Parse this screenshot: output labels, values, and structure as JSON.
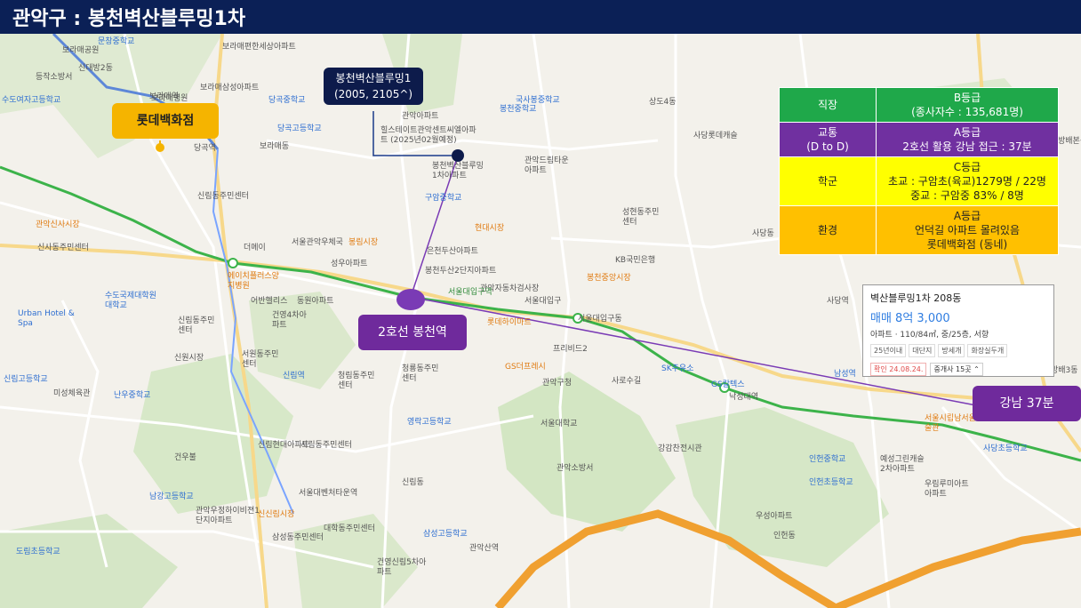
{
  "title": "관악구 : 봉천벽산블루밍1차",
  "complex_callout": {
    "line1": "봉천벽산블루밍1",
    "line2": "(2005, 2105^)"
  },
  "lotte_callout": "롯데백화점",
  "station_callout": "2호선 봉천역",
  "gangnam_callout": "강남 37분",
  "grades": [
    {
      "label": "직장",
      "grade": "B등급",
      "detail": [
        "(종사자수 : 135,681명)"
      ],
      "color": "#1fa84a"
    },
    {
      "label": "교통\n(D to D)",
      "grade": "A등급",
      "detail": [
        "2호선 활용 강남 접근 : 37분"
      ],
      "color": "#7030a0"
    },
    {
      "label": "학군",
      "grade": "C등급",
      "detail": [
        "초교 : 구암초(육교)1279명 / 22명",
        "중교 : 구암중 83% / 8명"
      ],
      "color": "#ffff00"
    },
    {
      "label": "환경",
      "grade": "A등급",
      "detail": [
        "언덕길 아파트 몰려있음",
        "롯데백화점 (동네)"
      ],
      "color": "#ffc000"
    }
  ],
  "listing": {
    "name": "벽산블루밍1차 208동",
    "price": "매매 8억 3,000",
    "spec": "아파트 · 110/84㎡, 중/25층, 서향",
    "tags": [
      "25년이내",
      "대단지",
      "방세개",
      "화장실두개"
    ],
    "confirmed": "확인 24.08.24.",
    "agents": "중개사 15곳 ⌃"
  },
  "map_labels": [
    "문창중학교",
    "보라매공원",
    "신대방2동",
    "등작소방서",
    "수도여자고등학교",
    "보라매병원",
    "보라매편한세상아파트",
    "보라매삼성아파트",
    "당곡중학교",
    "당곡고등학교",
    "보라매동",
    "봉천역",
    "당곡역",
    "신림동주민센터",
    "더메이",
    "서울관악우체국",
    "봉림시장",
    "성우아파트",
    "에이치플러스양지병원",
    "어반헬리스",
    "동원아파트",
    "건영4차아파트",
    "신림동주민센터",
    "서원동주민센터",
    "신림역",
    "은천두산아파트",
    "봉천두산2단지아파트",
    "관악자동차검사장",
    "서울대벤처타운역",
    "미성체육관",
    "신림고등학교",
    "난우중학교",
    "신림현대아파트",
    "서림동주민센터",
    "남강고등학교",
    "건우불",
    "관악우정하이비젼1단지아파트",
    "서울대벤처타운역",
    "신신림시장",
    "삼성동주민센터",
    "대학동주민센터",
    "서울대입구역",
    "관악구청",
    "낙성대역",
    "인헌동",
    "서울대학교",
    "관악소방서",
    "인헌초등학교",
    "관악아파트",
    "봉천중학교",
    "청림동주민센터",
    "구암중학교",
    "서울대입구",
    "현대시장",
    "관악드림타운아파트",
    "서울대입구동",
    "성현동주민센터",
    "KB국민은행",
    "서울대학교",
    "남성역",
    "사당동",
    "사당역",
    "서울시립남서울미술관",
    "사당초등학교",
    "방배3동",
    "낙성대역",
    "인헌중학교",
    "국사봉중학교",
    "상도4동",
    "구암중학교",
    "봉천중앙시장",
    "롯데하이마트",
    "GS더프레시",
    "프리비드2",
    "사로수길",
    "SK주유소",
    "GS칼텍스",
    "관악구청",
    "청룡동주민센터",
    "영락고등학교",
    "서울대학교",
    "신림동",
    "건영신림5차아파트",
    "관악산역",
    "삼성고등학교",
    "봉천역",
    "힐스테이트관악센트씨엘아파트 (2025년02월예정)",
    "봉천벽산블루밍1차아파트",
    "Urban Hotel & Spa",
    "보라매역",
    "사당롯데캐슬",
    "방배본동",
    "예성그린캐슬2차아파트",
    "우림루미아트아파트",
    "강감찬전시관",
    "우성아파트",
    "관악신사시장",
    "신사동주민센터",
    "도림초등학교",
    "수도국제대학원대학교",
    "신원시장"
  ]
}
